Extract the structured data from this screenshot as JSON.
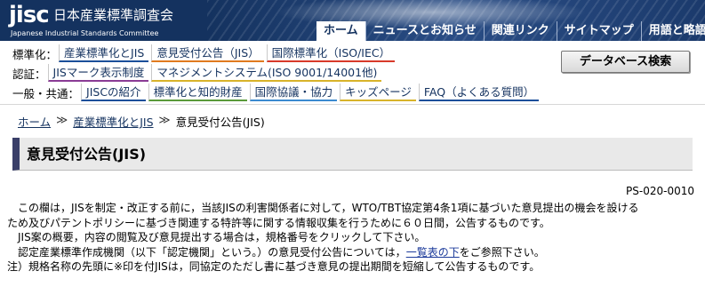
{
  "header": {
    "logo_mark": "jisc",
    "logo_ja": "日本産業標準調査会",
    "logo_en": "Japanese Industrial Standards Committee",
    "nav": [
      {
        "label": "ホーム",
        "active": true
      },
      {
        "label": "ニュースとお知らせ"
      },
      {
        "label": "関連リンク"
      },
      {
        "label": "サイトマップ"
      },
      {
        "label": "用語と略語"
      }
    ]
  },
  "catnav": {
    "row1": {
      "label": "標準化：",
      "links": [
        "産業標準化とJIS",
        "意見受付公告（JIS）",
        "国際標準化（ISO/IEC）"
      ]
    },
    "row2": {
      "label": "認証：",
      "links": [
        "JISマーク表示制度",
        "マネジメントシステム(ISO 9001/14001他)"
      ]
    },
    "row3": {
      "label": "一般・共通：",
      "links": [
        "JISCの紹介",
        "標準化と知的財産",
        "国際協議・協力",
        "キッズページ",
        "FAQ（よくある質問）"
      ]
    },
    "db_button": "データベース検索"
  },
  "breadcrumb": {
    "items": [
      "ホーム",
      "産業標準化とJIS",
      "意見受付公告(JIS)"
    ],
    "separator": "≫"
  },
  "page_title": "意見受付公告(JIS)",
  "doc_id": "PS-020-0010",
  "body": {
    "p1a": "　この欄は，JISを制定・改正する前に，当該JISの利害関係者に対して，WTO/TBT協定第4条1項に基づいた意見提出の機会を設ける",
    "p1b": "ため及びパテントポリシーに基づき関連する特許等に関する情報収集を行うために６０日間，公告するものです。",
    "p2": "　JIS案の概要，内容の閲覧及び意見提出する場合は，規格番号をクリックして下さい。",
    "p3_pre": "　認定産業標準作成機関（以下「認定機関」という。）の意見受付公告については，",
    "p3_link": "一覧表の下",
    "p3_post": "をご参照下さい。",
    "p4": "注）規格名称の先頭に※印を付JISは，同協定のただし書に基づき意見の提出期間を短縮して公告するものです。"
  },
  "colors": {
    "header_bg": "#14325f",
    "link": "#14325f",
    "title_accent": "#3a3f69"
  }
}
